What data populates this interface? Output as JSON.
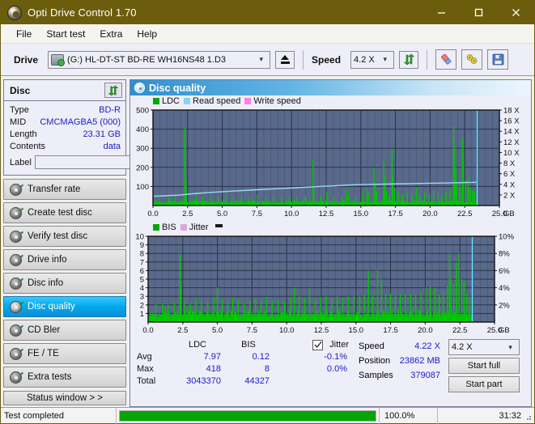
{
  "window": {
    "title": "Opti Drive Control 1.70",
    "icon": "disc-icon",
    "minimize": "minimize-icon",
    "maximize": "maximize-icon",
    "close": "close-icon",
    "titlebar_color": "#6b5d0c"
  },
  "menu": {
    "items": [
      "File",
      "Start test",
      "Extra",
      "Help"
    ]
  },
  "toolbar": {
    "drive_label": "Drive",
    "drive_value": "(G:)  HL-DT-ST BD-RE  WH16NS48 1.D3",
    "eject": "eject-icon",
    "speed_label": "Speed",
    "speed_value": "4.2 X",
    "refresh": "refresh-icon",
    "erase": "eraser-icon",
    "tools": "tools-icon",
    "save": "save-icon"
  },
  "sidebar": {
    "disc_panel": {
      "title": "Disc",
      "refresh_icon": "refresh-icon",
      "rows": [
        {
          "key": "Type",
          "value": "BD-R"
        },
        {
          "key": "MID",
          "value": "CMCMAGBA5 (000)"
        },
        {
          "key": "Length",
          "value": "23.31 GB"
        },
        {
          "key": "Contents",
          "value": "data"
        }
      ],
      "label_key": "Label",
      "label_value": "",
      "label_placeholder": "",
      "disc_button_icon": "disc-icon"
    },
    "nav": [
      {
        "label": "Transfer rate",
        "active": false
      },
      {
        "label": "Create test disc",
        "active": false
      },
      {
        "label": "Verify test disc",
        "active": false
      },
      {
        "label": "Drive info",
        "active": false
      },
      {
        "label": "Disc info",
        "active": false
      },
      {
        "label": "Disc quality",
        "active": true
      },
      {
        "label": "CD Bler",
        "active": false
      },
      {
        "label": "FE / TE",
        "active": false
      },
      {
        "label": "Extra tests",
        "active": false
      }
    ],
    "status_window_button": "Status window > >"
  },
  "main": {
    "header_title": "Disc quality",
    "header_icon": "disc-quality-icon"
  },
  "stats": {
    "columns": [
      "LDC",
      "BIS"
    ],
    "jitter_label": "Jitter",
    "jitter_checked": true,
    "rows": [
      {
        "label": "Avg",
        "ldc": "7.97",
        "bis": "0.12",
        "jitter": "-0.1%"
      },
      {
        "label": "Max",
        "ldc": "418",
        "bis": "8",
        "jitter": "0.0%"
      },
      {
        "label": "Total",
        "ldc": "3043370",
        "bis": "44327",
        "jitter": ""
      }
    ],
    "speed_label": "Speed",
    "speed_value": "4.22 X",
    "position_label": "Position",
    "position_value": "23862 MB",
    "samples_label": "Samples",
    "samples_value": "379087",
    "speed_select": "4.2 X",
    "start_full": "Start full",
    "start_part": "Start part"
  },
  "statusbar": {
    "message": "Test completed",
    "percent_text": "100.0%",
    "percent_value": 100,
    "elapsed": "31:32",
    "progress_color": "#06a406"
  },
  "chart_data": [
    {
      "id": "disc-quality-ldc-chart",
      "type": "area",
      "title": "",
      "legend": [
        {
          "label": "LDC",
          "color": "#00a800"
        },
        {
          "label": "Read speed",
          "color": "#87d3f0"
        },
        {
          "label": "Write speed",
          "color": "#ff80e0"
        }
      ],
      "legend_position": "top-left",
      "xlabel": "GB",
      "xlim": [
        0,
        25
      ],
      "xticks": [
        0.0,
        2.5,
        5.0,
        7.5,
        10.0,
        12.5,
        15.0,
        17.5,
        20.0,
        22.5,
        25.0
      ],
      "xticklabels": [
        "0.0",
        "2.5",
        "5.0",
        "7.5",
        "10.0",
        "12.5",
        "15.0",
        "17.5",
        "20.0",
        "22.5",
        "25.0"
      ],
      "ylabel": "LDC",
      "ylim": [
        0,
        500
      ],
      "yticks": [
        100,
        200,
        300,
        400,
        500
      ],
      "yticklabels": [
        "100",
        "200",
        "300",
        "400",
        "500"
      ],
      "y2label": "X",
      "y2lim": [
        0,
        18
      ],
      "y2ticks": [
        2,
        4,
        6,
        8,
        10,
        12,
        14,
        16,
        18
      ],
      "y2ticklabels": [
        "2 X",
        "4 X",
        "6 X",
        "8 X",
        "10 X",
        "12 X",
        "14 X",
        "16 X",
        "18 X"
      ],
      "grid": true,
      "plot_bg": "#59698c",
      "series": [
        {
          "name": "LDC",
          "color": "#00c800",
          "kind": "spikes",
          "baseline": 20,
          "noise_amp": 14,
          "spikes": [
            [
              2.3,
              405
            ],
            [
              2.33,
              320
            ],
            [
              2.38,
              130
            ],
            [
              2.42,
              70
            ],
            [
              0.45,
              45
            ],
            [
              1.1,
              40
            ],
            [
              1.6,
              55
            ],
            [
              3.1,
              60
            ],
            [
              3.55,
              48
            ],
            [
              4.1,
              52
            ],
            [
              4.7,
              46
            ],
            [
              5.25,
              58
            ],
            [
              5.8,
              44
            ],
            [
              6.4,
              50
            ],
            [
              6.95,
              42
            ],
            [
              7.55,
              60
            ],
            [
              8.15,
              46
            ],
            [
              8.7,
              44
            ],
            [
              9.3,
              52
            ],
            [
              9.85,
              48
            ],
            [
              10.4,
              44
            ],
            [
              11.0,
              52
            ],
            [
              11.55,
              240
            ],
            [
              11.6,
              90
            ],
            [
              12.1,
              48
            ],
            [
              12.55,
              72
            ],
            [
              13.05,
              50
            ],
            [
              13.6,
              46
            ],
            [
              13.95,
              88
            ],
            [
              14.1,
              58
            ],
            [
              14.6,
              52
            ],
            [
              15.1,
              60
            ],
            [
              15.45,
              92
            ],
            [
              15.55,
              64
            ],
            [
              15.95,
              196
            ],
            [
              16.05,
              120
            ],
            [
              16.15,
              70
            ],
            [
              16.65,
              232
            ],
            [
              16.75,
              150
            ],
            [
              16.85,
              78
            ],
            [
              17.05,
              60
            ],
            [
              17.25,
              295
            ],
            [
              17.3,
              160
            ],
            [
              17.45,
              90
            ],
            [
              17.7,
              74
            ],
            [
              18.0,
              58
            ],
            [
              18.35,
              70
            ],
            [
              18.7,
              62
            ],
            [
              19.0,
              96
            ],
            [
              19.25,
              58
            ],
            [
              19.6,
              66
            ],
            [
              19.95,
              60
            ],
            [
              20.25,
              78
            ],
            [
              20.55,
              64
            ],
            [
              20.85,
              58
            ],
            [
              21.15,
              70
            ],
            [
              21.45,
              88
            ],
            [
              21.7,
              415
            ],
            [
              21.75,
              300
            ],
            [
              21.85,
              200
            ],
            [
              21.95,
              120
            ],
            [
              22.15,
              108
            ],
            [
              22.35,
              350
            ],
            [
              22.4,
              250
            ],
            [
              22.55,
              130
            ],
            [
              22.75,
              148
            ],
            [
              22.9,
              96
            ],
            [
              23.05,
              80
            ],
            [
              23.2,
              72
            ]
          ],
          "end_x": 23.4
        },
        {
          "name": "Read speed",
          "color": "#9bd8f5",
          "kind": "line",
          "axis": "y2",
          "points": [
            [
              0.05,
              1.75
            ],
            [
              1.0,
              1.85
            ],
            [
              2.0,
              2.0
            ],
            [
              3.0,
              2.25
            ],
            [
              4.0,
              2.45
            ],
            [
              5.0,
              2.6
            ],
            [
              6.0,
              2.75
            ],
            [
              7.0,
              2.9
            ],
            [
              8.0,
              3.05
            ],
            [
              9.0,
              3.2
            ],
            [
              10.0,
              3.3
            ],
            [
              11.0,
              3.45
            ],
            [
              12.0,
              3.6
            ],
            [
              13.0,
              3.7
            ],
            [
              14.0,
              3.85
            ],
            [
              15.0,
              3.95
            ],
            [
              16.0,
              4.0
            ],
            [
              17.0,
              4.05
            ],
            [
              18.0,
              4.1
            ],
            [
              19.0,
              4.15
            ],
            [
              20.0,
              4.2
            ],
            [
              21.0,
              4.25
            ],
            [
              22.0,
              4.3
            ],
            [
              23.0,
              4.35
            ],
            [
              23.35,
              4.4
            ]
          ]
        },
        {
          "name": "End marker",
          "color": "#55d8ff",
          "kind": "vline",
          "x": 23.4
        }
      ]
    },
    {
      "id": "disc-quality-bis-chart",
      "type": "area",
      "title": "",
      "legend": [
        {
          "label": "BIS",
          "color": "#00a800"
        },
        {
          "label": "Jitter",
          "color": "#d9a8d9"
        }
      ],
      "legend_position": "top-left",
      "xlabel": "GB",
      "xlim": [
        0,
        25
      ],
      "xticks": [
        0.0,
        2.5,
        5.0,
        7.5,
        10.0,
        12.5,
        15.0,
        17.5,
        20.0,
        22.5,
        25.0
      ],
      "xticklabels": [
        "0.0",
        "2.5",
        "5.0",
        "7.5",
        "10.0",
        "12.5",
        "15.0",
        "17.5",
        "20.0",
        "22.5",
        "25.0"
      ],
      "ylabel": "BIS",
      "ylim": [
        0,
        10
      ],
      "yticks": [
        1,
        2,
        3,
        4,
        5,
        6,
        7,
        8,
        9,
        10
      ],
      "yticklabels": [
        "1",
        "2",
        "3",
        "4",
        "5",
        "6",
        "7",
        "8",
        "9",
        "10"
      ],
      "y2label": "%",
      "y2lim": [
        0,
        10
      ],
      "y2ticks": [
        2,
        4,
        6,
        8,
        10
      ],
      "y2ticklabels": [
        "2%",
        "4%",
        "6%",
        "8%",
        "10%"
      ],
      "grid": true,
      "plot_bg": "#59698c",
      "series": [
        {
          "name": "BIS",
          "color": "#00c800",
          "kind": "spikes",
          "baseline": 1.0,
          "noise_amp": 0.85,
          "spikes": [
            [
              2.3,
              8.0
            ],
            [
              2.35,
              4.2
            ],
            [
              0.55,
              2.1
            ],
            [
              1.05,
              2.2
            ],
            [
              1.45,
              2.0
            ],
            [
              1.9,
              2.3
            ],
            [
              2.6,
              2.4
            ],
            [
              3.05,
              2.2
            ],
            [
              3.45,
              2.8
            ],
            [
              3.85,
              2.5
            ],
            [
              4.3,
              2.3
            ],
            [
              4.75,
              2.9
            ],
            [
              5.0,
              4.0
            ],
            [
              5.35,
              2.6
            ],
            [
              5.75,
              2.4
            ],
            [
              6.1,
              2.8
            ],
            [
              6.5,
              2.6
            ],
            [
              6.95,
              2.3
            ],
            [
              7.35,
              2.5
            ],
            [
              7.75,
              2.7
            ],
            [
              8.15,
              2.4
            ],
            [
              8.55,
              2.9
            ],
            [
              8.95,
              2.5
            ],
            [
              9.4,
              2.6
            ],
            [
              9.85,
              2.4
            ],
            [
              10.3,
              2.9
            ],
            [
              10.55,
              4.0
            ],
            [
              10.9,
              3.0
            ],
            [
              11.3,
              2.8
            ],
            [
              11.65,
              4.0
            ],
            [
              12.05,
              2.7
            ],
            [
              12.45,
              2.9
            ],
            [
              12.85,
              3.0
            ],
            [
              13.25,
              2.8
            ],
            [
              13.65,
              3.0
            ],
            [
              14.05,
              2.9
            ],
            [
              14.45,
              3.0
            ],
            [
              14.85,
              3.1
            ],
            [
              15.25,
              3.0
            ],
            [
              15.6,
              3.2
            ],
            [
              15.9,
              6.0
            ],
            [
              16.2,
              3.1
            ],
            [
              16.55,
              6.1
            ],
            [
              16.85,
              5.0
            ],
            [
              17.15,
              3.2
            ],
            [
              17.5,
              3.3
            ],
            [
              17.85,
              3.1
            ],
            [
              18.2,
              3.3
            ],
            [
              18.55,
              3.2
            ],
            [
              18.95,
              3.4
            ],
            [
              19.3,
              3.2
            ],
            [
              19.7,
              3.3
            ],
            [
              20.05,
              4.0
            ],
            [
              20.35,
              4.1
            ],
            [
              20.7,
              4.0
            ],
            [
              21.0,
              3.2
            ],
            [
              21.3,
              3.4
            ],
            [
              21.6,
              4.2
            ],
            [
              21.75,
              8.0
            ],
            [
              21.85,
              5.0
            ],
            [
              22.05,
              4.3
            ],
            [
              22.25,
              7.0
            ],
            [
              22.45,
              8.0
            ],
            [
              22.6,
              5.0
            ],
            [
              22.8,
              4.8
            ],
            [
              23.0,
              3.2
            ],
            [
              23.2,
              3.0
            ]
          ],
          "end_x": 23.4
        },
        {
          "name": "End marker",
          "color": "#55d8ff",
          "kind": "vline",
          "x": 23.4
        }
      ]
    }
  ]
}
